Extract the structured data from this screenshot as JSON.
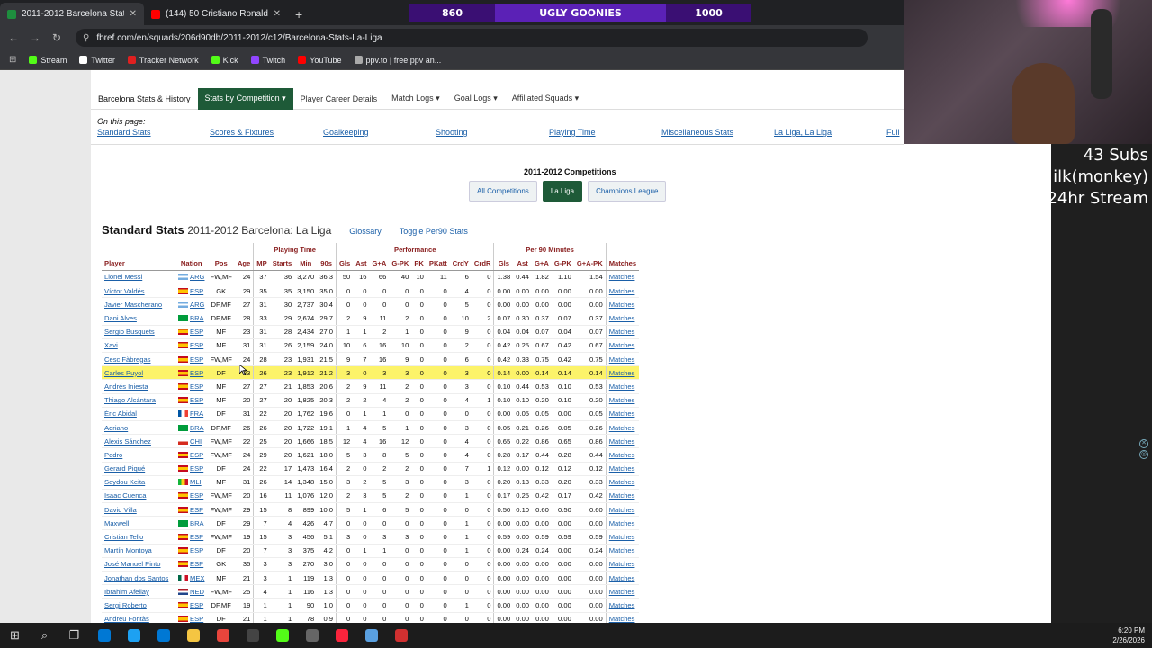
{
  "browser": {
    "tabs": [
      {
        "title": "2011-2012 Barcelona Stats, La L",
        "active": true,
        "color": "#1e8e3e"
      },
      {
        "title": "(144) 50 Cristiano Ronaldo Skil",
        "active": false,
        "color": "#ff0000"
      }
    ],
    "url": "fbref.com/en/squads/206d90db/2011-2012/c12/Barcelona-Stats-La-Liga",
    "bookmarks": [
      {
        "label": "Stream",
        "color": "#53fc18"
      },
      {
        "label": "Twitter",
        "color": "#ffffff"
      },
      {
        "label": "Tracker Network",
        "color": "#e02020"
      },
      {
        "label": "Kick",
        "color": "#53fc18"
      },
      {
        "label": "Twitch",
        "color": "#9146ff"
      },
      {
        "label": "YouTube",
        "color": "#ff0000"
      },
      {
        "label": "ppv.to | free ppv an...",
        "color": "#aaaaaa"
      }
    ]
  },
  "stream_overlay": {
    "left_count": "860",
    "title": "UGLY GOONIES",
    "right_count": "1000",
    "subs": "43 Subs",
    "line2": "ilk(monkey)",
    "line3": "24hr Stream"
  },
  "site_nav": {
    "items": [
      {
        "label": "Barcelona Stats & History",
        "style": "first"
      },
      {
        "label": "Stats by Competition ▾",
        "style": "active"
      },
      {
        "label": "Player Career Details",
        "style": "u"
      },
      {
        "label": "Match Logs ▾",
        "style": "plain"
      },
      {
        "label": "Goal Logs ▾",
        "style": "plain"
      },
      {
        "label": "Affiliated Squads ▾",
        "style": "plain"
      }
    ]
  },
  "on_this_page": {
    "heading": "On this page:",
    "links": [
      "Standard Stats",
      "Scores & Fixtures",
      "Goalkeeping",
      "Shooting",
      "Playing Time",
      "Miscellaneous Stats",
      "La Liga, La Liga",
      "Full"
    ]
  },
  "competitions": {
    "title": "2011-2012 Competitions",
    "buttons": [
      {
        "label": "All Competitions",
        "active": false
      },
      {
        "label": "La Liga",
        "active": true
      },
      {
        "label": "Champions League",
        "active": false
      }
    ]
  },
  "table": {
    "title": "Standard Stats",
    "subtitle": "2011-2012 Barcelona: La Liga",
    "glossary": "Glossary",
    "toggle": "Toggle Per90 Stats",
    "groups": [
      "",
      "Playing Time",
      "Performance",
      "Per 90 Minutes",
      ""
    ],
    "columns": [
      "Player",
      "Nation",
      "Pos",
      "Age",
      "MP",
      "Starts",
      "Min",
      "90s",
      "Gls",
      "Ast",
      "G+A",
      "G-PK",
      "PK",
      "PKatt",
      "CrdY",
      "CrdR",
      "Gls",
      "Ast",
      "G+A",
      "G-PK",
      "G+A-PK",
      "Matches"
    ],
    "highlight_row": 7,
    "rows": [
      [
        "Lionel Messi",
        "ARG",
        "FW,MF",
        "24",
        "37",
        "36",
        "3,270",
        "36.3",
        "50",
        "16",
        "66",
        "40",
        "10",
        "11",
        "6",
        "0",
        "1.38",
        "0.44",
        "1.82",
        "1.10",
        "1.54",
        "Matches"
      ],
      [
        "Víctor Valdés",
        "ESP",
        "GK",
        "29",
        "35",
        "35",
        "3,150",
        "35.0",
        "0",
        "0",
        "0",
        "0",
        "0",
        "0",
        "4",
        "0",
        "0.00",
        "0.00",
        "0.00",
        "0.00",
        "0.00",
        "Matches"
      ],
      [
        "Javier Mascherano",
        "ARG",
        "DF,MF",
        "27",
        "31",
        "30",
        "2,737",
        "30.4",
        "0",
        "0",
        "0",
        "0",
        "0",
        "0",
        "5",
        "0",
        "0.00",
        "0.00",
        "0.00",
        "0.00",
        "0.00",
        "Matches"
      ],
      [
        "Dani Alves",
        "BRA",
        "DF,MF",
        "28",
        "33",
        "29",
        "2,674",
        "29.7",
        "2",
        "9",
        "11",
        "2",
        "0",
        "0",
        "10",
        "2",
        "0.07",
        "0.30",
        "0.37",
        "0.07",
        "0.37",
        "Matches"
      ],
      [
        "Sergio Busquets",
        "ESP",
        "MF",
        "23",
        "31",
        "28",
        "2,434",
        "27.0",
        "1",
        "1",
        "2",
        "1",
        "0",
        "0",
        "9",
        "0",
        "0.04",
        "0.04",
        "0.07",
        "0.04",
        "0.07",
        "Matches"
      ],
      [
        "Xavi",
        "ESP",
        "MF",
        "31",
        "31",
        "26",
        "2,159",
        "24.0",
        "10",
        "6",
        "16",
        "10",
        "0",
        "0",
        "2",
        "0",
        "0.42",
        "0.25",
        "0.67",
        "0.42",
        "0.67",
        "Matches"
      ],
      [
        "Cesc Fàbregas",
        "ESP",
        "FW,MF",
        "24",
        "28",
        "23",
        "1,931",
        "21.5",
        "9",
        "7",
        "16",
        "9",
        "0",
        "0",
        "6",
        "0",
        "0.42",
        "0.33",
        "0.75",
        "0.42",
        "0.75",
        "Matches"
      ],
      [
        "Carles Puyol",
        "ESP",
        "DF",
        "33",
        "26",
        "23",
        "1,912",
        "21.2",
        "3",
        "0",
        "3",
        "3",
        "0",
        "0",
        "3",
        "0",
        "0.14",
        "0.00",
        "0.14",
        "0.14",
        "0.14",
        "Matches"
      ],
      [
        "Andrés Iniesta",
        "ESP",
        "MF",
        "27",
        "27",
        "21",
        "1,853",
        "20.6",
        "2",
        "9",
        "11",
        "2",
        "0",
        "0",
        "3",
        "0",
        "0.10",
        "0.44",
        "0.53",
        "0.10",
        "0.53",
        "Matches"
      ],
      [
        "Thiago Alcántara",
        "ESP",
        "MF",
        "20",
        "27",
        "20",
        "1,825",
        "20.3",
        "2",
        "2",
        "4",
        "2",
        "0",
        "0",
        "4",
        "1",
        "0.10",
        "0.10",
        "0.20",
        "0.10",
        "0.20",
        "Matches"
      ],
      [
        "Éric Abidal",
        "FRA",
        "DF",
        "31",
        "22",
        "20",
        "1,762",
        "19.6",
        "0",
        "1",
        "1",
        "0",
        "0",
        "0",
        "0",
        "0",
        "0.00",
        "0.05",
        "0.05",
        "0.00",
        "0.05",
        "Matches"
      ],
      [
        "Adriano",
        "BRA",
        "DF,MF",
        "26",
        "26",
        "20",
        "1,722",
        "19.1",
        "1",
        "4",
        "5",
        "1",
        "0",
        "0",
        "3",
        "0",
        "0.05",
        "0.21",
        "0.26",
        "0.05",
        "0.26",
        "Matches"
      ],
      [
        "Alexis Sánchez",
        "CHI",
        "FW,MF",
        "22",
        "25",
        "20",
        "1,666",
        "18.5",
        "12",
        "4",
        "16",
        "12",
        "0",
        "0",
        "4",
        "0",
        "0.65",
        "0.22",
        "0.86",
        "0.65",
        "0.86",
        "Matches"
      ],
      [
        "Pedro",
        "ESP",
        "FW,MF",
        "24",
        "29",
        "20",
        "1,621",
        "18.0",
        "5",
        "3",
        "8",
        "5",
        "0",
        "0",
        "4",
        "0",
        "0.28",
        "0.17",
        "0.44",
        "0.28",
        "0.44",
        "Matches"
      ],
      [
        "Gerard Piqué",
        "ESP",
        "DF",
        "24",
        "22",
        "17",
        "1,473",
        "16.4",
        "2",
        "0",
        "2",
        "2",
        "0",
        "0",
        "7",
        "1",
        "0.12",
        "0.00",
        "0.12",
        "0.12",
        "0.12",
        "Matches"
      ],
      [
        "Seydou Keita",
        "MLI",
        "MF",
        "31",
        "26",
        "14",
        "1,348",
        "15.0",
        "3",
        "2",
        "5",
        "3",
        "0",
        "0",
        "3",
        "0",
        "0.20",
        "0.13",
        "0.33",
        "0.20",
        "0.33",
        "Matches"
      ],
      [
        "Isaac Cuenca",
        "ESP",
        "FW,MF",
        "20",
        "16",
        "11",
        "1,076",
        "12.0",
        "2",
        "3",
        "5",
        "2",
        "0",
        "0",
        "1",
        "0",
        "0.17",
        "0.25",
        "0.42",
        "0.17",
        "0.42",
        "Matches"
      ],
      [
        "David Villa",
        "ESP",
        "FW,MF",
        "29",
        "15",
        "8",
        "899",
        "10.0",
        "5",
        "1",
        "6",
        "5",
        "0",
        "0",
        "0",
        "0",
        "0.50",
        "0.10",
        "0.60",
        "0.50",
        "0.60",
        "Matches"
      ],
      [
        "Maxwell",
        "BRA",
        "DF",
        "29",
        "7",
        "4",
        "426",
        "4.7",
        "0",
        "0",
        "0",
        "0",
        "0",
        "0",
        "1",
        "0",
        "0.00",
        "0.00",
        "0.00",
        "0.00",
        "0.00",
        "Matches"
      ],
      [
        "Cristian Tello",
        "ESP",
        "FW,MF",
        "19",
        "15",
        "3",
        "456",
        "5.1",
        "3",
        "0",
        "3",
        "3",
        "0",
        "0",
        "1",
        "0",
        "0.59",
        "0.00",
        "0.59",
        "0.59",
        "0.59",
        "Matches"
      ],
      [
        "Martín Montoya",
        "ESP",
        "DF",
        "20",
        "7",
        "3",
        "375",
        "4.2",
        "0",
        "1",
        "1",
        "0",
        "0",
        "0",
        "1",
        "0",
        "0.00",
        "0.24",
        "0.24",
        "0.00",
        "0.24",
        "Matches"
      ],
      [
        "José Manuel Pinto",
        "ESP",
        "GK",
        "35",
        "3",
        "3",
        "270",
        "3.0",
        "0",
        "0",
        "0",
        "0",
        "0",
        "0",
        "0",
        "0",
        "0.00",
        "0.00",
        "0.00",
        "0.00",
        "0.00",
        "Matches"
      ],
      [
        "Jonathan dos Santos",
        "MEX",
        "MF",
        "21",
        "3",
        "1",
        "119",
        "1.3",
        "0",
        "0",
        "0",
        "0",
        "0",
        "0",
        "0",
        "0",
        "0.00",
        "0.00",
        "0.00",
        "0.00",
        "0.00",
        "Matches"
      ],
      [
        "Ibrahim Afellay",
        "NED",
        "FW,MF",
        "25",
        "4",
        "1",
        "116",
        "1.3",
        "0",
        "0",
        "0",
        "0",
        "0",
        "0",
        "0",
        "0",
        "0.00",
        "0.00",
        "0.00",
        "0.00",
        "0.00",
        "Matches"
      ],
      [
        "Sergi Roberto",
        "ESP",
        "DF,MF",
        "19",
        "1",
        "1",
        "90",
        "1.0",
        "0",
        "0",
        "0",
        "0",
        "0",
        "0",
        "1",
        "0",
        "0.00",
        "0.00",
        "0.00",
        "0.00",
        "0.00",
        "Matches"
      ],
      [
        "Andreu Fontàs",
        "ESP",
        "DF",
        "21",
        "1",
        "1",
        "78",
        "0.9",
        "0",
        "0",
        "0",
        "0",
        "0",
        "0",
        "0",
        "0",
        "0.00",
        "0.00",
        "0.00",
        "0.00",
        "0.00",
        "Matches"
      ]
    ]
  },
  "taskbar": {
    "time": "6:20 PM",
    "date": "2/26/2026",
    "apps": [
      {
        "icon": "windows-icon",
        "glyph": "⊞",
        "color": ""
      },
      {
        "icon": "search-icon",
        "glyph": "⌕",
        "color": ""
      },
      {
        "icon": "task-view-icon",
        "glyph": "❐",
        "color": ""
      },
      {
        "icon": "store-icon",
        "glyph": "",
        "color": "#0078d4"
      },
      {
        "icon": "edge-icon",
        "glyph": "",
        "color": "#1da1f2"
      },
      {
        "icon": "mail-icon",
        "glyph": "",
        "color": "#0078d4"
      },
      {
        "icon": "folder-icon",
        "glyph": "",
        "color": "#f4c542"
      },
      {
        "icon": "chrome-icon",
        "glyph": "",
        "color": "#e8453c"
      },
      {
        "icon": "obs-icon",
        "glyph": "",
        "color": "#444444"
      },
      {
        "icon": "kick-icon",
        "glyph": "",
        "color": "#53fc18"
      },
      {
        "icon": "steam-icon",
        "glyph": "",
        "color": "#666666"
      },
      {
        "icon": "music-icon",
        "glyph": "",
        "color": "#fa243c"
      },
      {
        "icon": "app-icon",
        "glyph": "",
        "color": "#5aa0e0"
      },
      {
        "icon": "game-icon",
        "glyph": "",
        "color": "#d03030"
      }
    ]
  }
}
